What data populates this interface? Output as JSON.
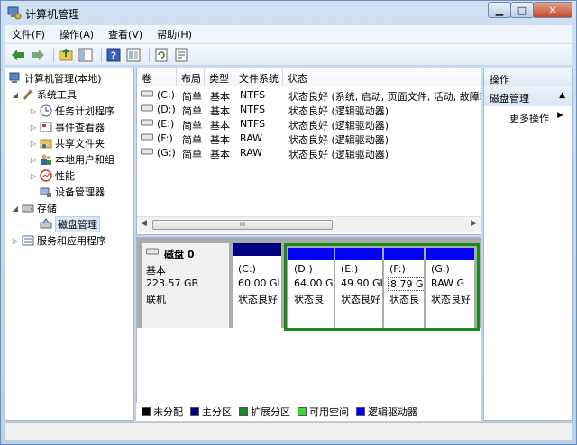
{
  "window": {
    "title": "计算机管理"
  },
  "menu": [
    "文件(F)",
    "操作(A)",
    "查看(V)",
    "帮助(H)"
  ],
  "tree": {
    "root": "计算机管理(本地)",
    "system_tools": "系统工具",
    "items": [
      "任务计划程序",
      "事件查看器",
      "共享文件夹",
      "本地用户和组",
      "性能",
      "设备管理器"
    ],
    "storage": "存储",
    "disk_mgmt": "磁盘管理",
    "services": "服务和应用程序"
  },
  "columns": [
    "卷",
    "布局",
    "类型",
    "文件系统",
    "状态"
  ],
  "volumes": [
    {
      "vol": "(C:)",
      "layout": "简单",
      "type": "基本",
      "fs": "NTFS",
      "status": "状态良好 (系统, 启动, 页面文件, 活动, 故障转"
    },
    {
      "vol": "(D:)",
      "layout": "简单",
      "type": "基本",
      "fs": "NTFS",
      "status": "状态良好 (逻辑驱动器)"
    },
    {
      "vol": "(E:)",
      "layout": "简单",
      "type": "基本",
      "fs": "NTFS",
      "status": "状态良好 (逻辑驱动器)"
    },
    {
      "vol": "(F:)",
      "layout": "简单",
      "type": "基本",
      "fs": "RAW",
      "status": "状态良好 (逻辑驱动器)"
    },
    {
      "vol": "(G:)",
      "layout": "简单",
      "type": "基本",
      "fs": "RAW",
      "status": "状态良好 (逻辑驱动器)"
    }
  ],
  "scroll_grip": "III",
  "disk": {
    "name": "磁盘 0",
    "kind": "基本",
    "size": "223.57 GB",
    "state": "联机"
  },
  "partitions": [
    {
      "letter": "(C:)",
      "size": "60.00 GI",
      "status": "状态良好",
      "color": "#000080"
    },
    {
      "letter": "(D:)",
      "size": "64.00 G",
      "status": "状态良",
      "color": "#0000ff"
    },
    {
      "letter": "(E:)",
      "size": "49.90 GI",
      "status": "状态良好",
      "color": "#0000ff"
    },
    {
      "letter": "(F:)",
      "size": "8.79 GB",
      "status": "状态良",
      "color": "#0000ff"
    },
    {
      "letter": "(G:)",
      "size": "RAW G",
      "status": "状态良好",
      "color": "#0000ff"
    }
  ],
  "legend": [
    {
      "label": "未分配",
      "color": "#000000"
    },
    {
      "label": "主分区",
      "color": "#000080"
    },
    {
      "label": "扩展分区",
      "color": "#1a8a1a"
    },
    {
      "label": "可用空间",
      "color": "#33dd33"
    },
    {
      "label": "逻辑驱动器",
      "color": "#0000ff"
    }
  ],
  "actions": {
    "header": "操作",
    "section": "磁盘管理",
    "more": "更多操作"
  }
}
